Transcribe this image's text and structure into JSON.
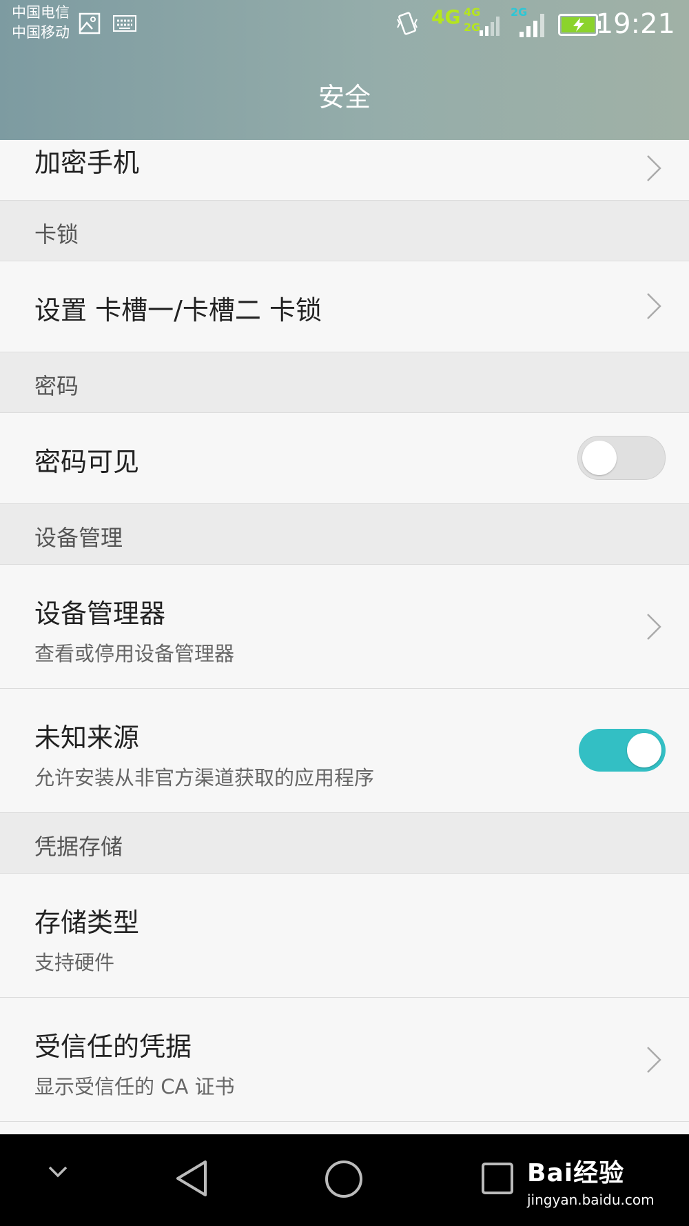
{
  "statusbar": {
    "carrier_1": "中国电信",
    "carrier_2": "中国移动",
    "network_main": "4G",
    "network_sim2_top": "4G",
    "network_sim2_bottom": "2G",
    "network_sim3": "2G",
    "time": "19:21",
    "icons": [
      "image-icon",
      "keyboard-icon",
      "vibrate-icon",
      "signal-icon",
      "battery-charging-icon"
    ]
  },
  "header": {
    "title": "安全"
  },
  "items": {
    "encrypt_phone": "加密手机",
    "sim_lock_section": "卡锁",
    "sim_lock": "设置 卡槽一/卡槽二 卡锁",
    "password_section": "密码",
    "password_visible": "密码可见",
    "device_admin_section": "设备管理",
    "device_admin_title": "设备管理器",
    "device_admin_sub": "查看或停用设备管理器",
    "unknown_sources_title": "未知来源",
    "unknown_sources_sub": "允许安装从非官方渠道获取的应用程序",
    "credential_section": "凭据存储",
    "storage_type_title": "存储类型",
    "storage_type_sub": "支持硬件",
    "trusted_cred_title": "受信任的凭据",
    "trusted_cred_sub": "显示受信任的 CA 证书"
  },
  "toggles": {
    "password_visible": false,
    "unknown_sources": true
  },
  "colors": {
    "accent": "#33bfc4",
    "header": "#8fa8a8"
  },
  "watermark": {
    "brand": "Bai经验",
    "url": "jingyan.baidu.com"
  }
}
